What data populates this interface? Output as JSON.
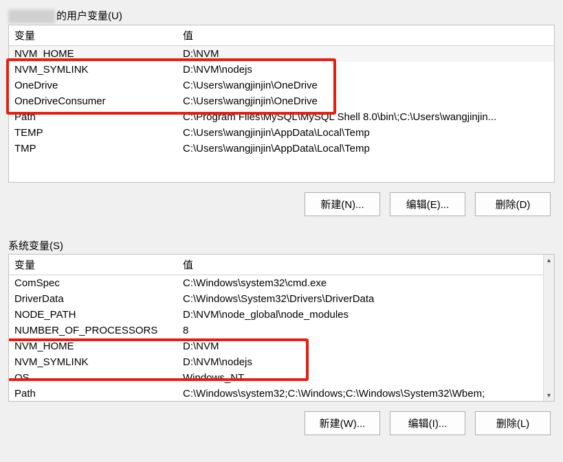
{
  "user_section": {
    "label_suffix": "的用户变量(U)",
    "columns": {
      "var": "变量",
      "val": "值"
    },
    "rows": [
      {
        "var": "NVM_HOME",
        "val": "D:\\NVM"
      },
      {
        "var": "NVM_SYMLINK",
        "val": "D:\\NVM\\nodejs"
      },
      {
        "var": "OneDrive",
        "val": "C:\\Users\\wangjinjin\\OneDrive"
      },
      {
        "var": "OneDriveConsumer",
        "val": "C:\\Users\\wangjinjin\\OneDrive"
      },
      {
        "var": "Path",
        "val": "C:\\Program Files\\MySQL\\MySQL Shell 8.0\\bin\\;C:\\Users\\wangjinjin..."
      },
      {
        "var": "TEMP",
        "val": "C:\\Users\\wangjinjin\\AppData\\Local\\Temp"
      },
      {
        "var": "TMP",
        "val": "C:\\Users\\wangjinjin\\AppData\\Local\\Temp"
      }
    ],
    "buttons": {
      "new": "新建(N)...",
      "edit": "编辑(E)...",
      "delete": "删除(D)"
    }
  },
  "system_section": {
    "label": "系统变量(S)",
    "columns": {
      "var": "变量",
      "val": "值"
    },
    "rows": [
      {
        "var": "ComSpec",
        "val": "C:\\Windows\\system32\\cmd.exe"
      },
      {
        "var": "DriverData",
        "val": "C:\\Windows\\System32\\Drivers\\DriverData"
      },
      {
        "var": "NODE_PATH",
        "val": "D:\\NVM\\node_global\\node_modules"
      },
      {
        "var": "NUMBER_OF_PROCESSORS",
        "val": "8"
      },
      {
        "var": "NVM_HOME",
        "val": "D:\\NVM"
      },
      {
        "var": "NVM_SYMLINK",
        "val": "D:\\NVM\\nodejs"
      },
      {
        "var": "OS",
        "val": "Windows_NT"
      },
      {
        "var": "Path",
        "val": "C:\\Windows\\system32;C:\\Windows;C:\\Windows\\System32\\Wbem;"
      }
    ],
    "buttons": {
      "new": "新建(W)...",
      "edit": "编辑(I)...",
      "delete": "删除(L)"
    }
  }
}
